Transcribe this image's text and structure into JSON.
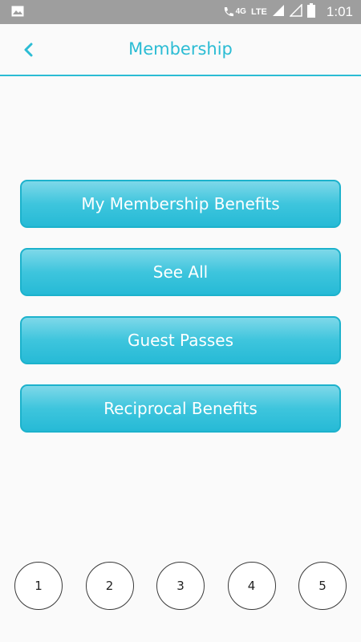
{
  "status_bar": {
    "network_label": "4G",
    "lte_label": "LTE",
    "time": "1:01",
    "icons": [
      "image-icon",
      "call-wifi-icon",
      "signal-icon",
      "signal-empty-icon",
      "battery-icon"
    ]
  },
  "header": {
    "back_icon": "chevron-left-icon",
    "back_glyph": "‹",
    "title": "Membership"
  },
  "menu": {
    "items": [
      {
        "label": "My Membership Benefits"
      },
      {
        "label": "See All"
      },
      {
        "label": "Guest Passes"
      },
      {
        "label": "Reciprocal Benefits"
      }
    ]
  },
  "pager": {
    "pages": [
      "1",
      "2",
      "3",
      "4",
      "5"
    ]
  },
  "colors": {
    "accent": "#2bbcd4",
    "status_bar": "#9e9e9e",
    "background": "#fafafa"
  }
}
